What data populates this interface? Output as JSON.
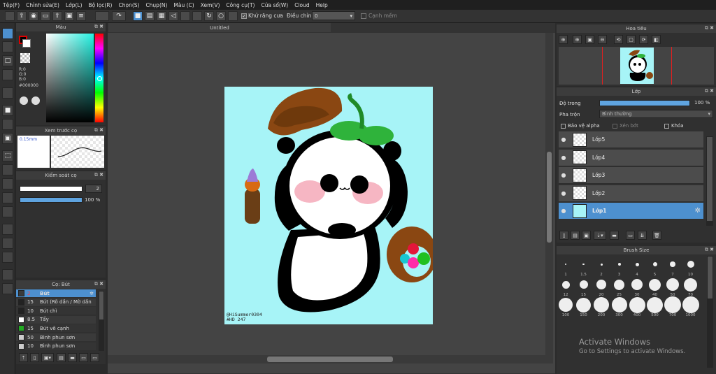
{
  "menu": [
    "Tệp(F)",
    "Chỉnh sửa(E)",
    "Lớp(L)",
    "Bộ lọc(R)",
    "Chọn(S)",
    "Chụp(N)",
    "Màu (C)",
    "Xem(V)",
    "Công cụ(T)",
    "Cửa sổ(W)",
    "Cloud",
    "Help"
  ],
  "toolbar": {
    "antialias_label": "Khử răng cưa",
    "adjust_label": "Điều chỉnh",
    "adjust_value": "0",
    "soft_edge_label": "Cạnh mềm"
  },
  "color_panel": {
    "title": "Màu",
    "r": "R:0",
    "g": "G:0",
    "b": "B:0",
    "hex": "#000000",
    "fg_color": "#000000",
    "bg_color": "#ffffff"
  },
  "preview_panel": {
    "title": "Xem trước cọ",
    "size": "0.15mm"
  },
  "brush_control": {
    "title": "Kiểm soát cọ",
    "size_value": "2",
    "opacity_value": "100 %",
    "opacity": 1.0
  },
  "brush_list": {
    "title": "Cọ: Bút",
    "items": [
      {
        "size": "2",
        "name": "Bút",
        "color": "#3a3a3a",
        "selected": true
      },
      {
        "size": "15",
        "name": "Bút (Rõ dần / Mờ dần",
        "color": "#222222",
        "selected": false
      },
      {
        "size": "10",
        "name": "Bút chì",
        "color": "#222222",
        "selected": false
      },
      {
        "size": "8.5",
        "name": "Tẩy",
        "color": "#ffffff",
        "selected": false
      },
      {
        "size": "15",
        "name": "Bút vẽ cạnh",
        "color": "#22aa22",
        "selected": false
      },
      {
        "size": "50",
        "name": "Bình phun sơn",
        "color": "#cccccc",
        "selected": false
      },
      {
        "size": "10",
        "name": "Bình phun sơn",
        "color": "#cccccc",
        "selected": false
      }
    ]
  },
  "canvas": {
    "tab_title": "Untitled",
    "signature": "@HiSummer0304",
    "tag": "#HD 247",
    "bg": "#a7f4f7"
  },
  "navigator": {
    "title": "Hoa tiêu"
  },
  "layer_panel": {
    "title": "Lớp",
    "opacity_label": "Độ trong",
    "opacity_value": "100 %",
    "opacity": 1.0,
    "blend_label": "Pha trộn",
    "blend_value": "Bình thường",
    "protect_alpha": "Bảo vệ alpha",
    "clipping": "Xén bớt",
    "lock": "Khóa",
    "layers": [
      {
        "name": "Lớp5",
        "selected": false
      },
      {
        "name": "Lớp4",
        "selected": false
      },
      {
        "name": "Lớp3",
        "selected": false
      },
      {
        "name": "Lớp2",
        "selected": false
      },
      {
        "name": "Lớp1",
        "selected": true
      }
    ]
  },
  "brush_size": {
    "title": "Brush Size",
    "sizes": [
      "1",
      "1.5",
      "2",
      "3",
      "4",
      "5",
      "7",
      "10",
      "12",
      "15",
      "20",
      "25",
      "30",
      "40",
      "50",
      "70",
      "100",
      "150",
      "200",
      "300",
      "400",
      "500",
      "700",
      "1000"
    ]
  },
  "watermark": {
    "line1": "Activate Windows",
    "line2": "Go to Settings to activate Windows."
  }
}
